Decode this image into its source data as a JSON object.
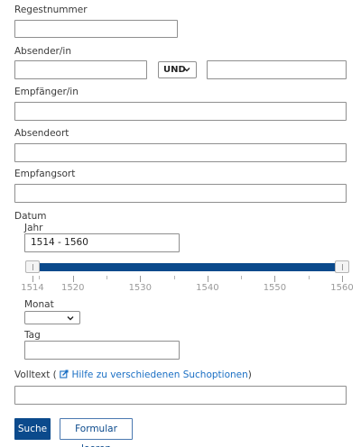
{
  "form": {
    "regestnummer": {
      "label": "Regestnummer",
      "value": ""
    },
    "absender": {
      "label": "Absender/in",
      "value_left": "",
      "operator": "UND",
      "value_right": ""
    },
    "empfaenger": {
      "label": "Empfänger/in",
      "value": ""
    },
    "absendeort": {
      "label": "Absendeort",
      "value": ""
    },
    "empfangsort": {
      "label": "Empfangsort",
      "value": ""
    },
    "datum": {
      "label": "Datum",
      "jahr": {
        "label": "Jahr",
        "value": "1514 - 1560",
        "slider": {
          "min": 1514,
          "max": 1560,
          "low": 1514,
          "high": 1560,
          "tick_labels": [
            "1514",
            "1520",
            "1530",
            "1540",
            "1550",
            "1560"
          ]
        }
      },
      "monat": {
        "label": "Monat",
        "value": ""
      },
      "tag": {
        "label": "Tag",
        "value": ""
      }
    },
    "volltext": {
      "label": "Volltext (",
      "help_link": "Hilfe zu verschiedenen Suchoptionen",
      "label_close": ")",
      "value": ""
    }
  },
  "buttons": {
    "search": "Suche",
    "reset": "Formular leeren"
  },
  "colors": {
    "primary": "#0b4a8c",
    "link": "#1a6fc4",
    "border": "#8f8f8f"
  },
  "icons": {
    "help": "external-link-edit-icon",
    "select": "chevron-down-icon"
  }
}
